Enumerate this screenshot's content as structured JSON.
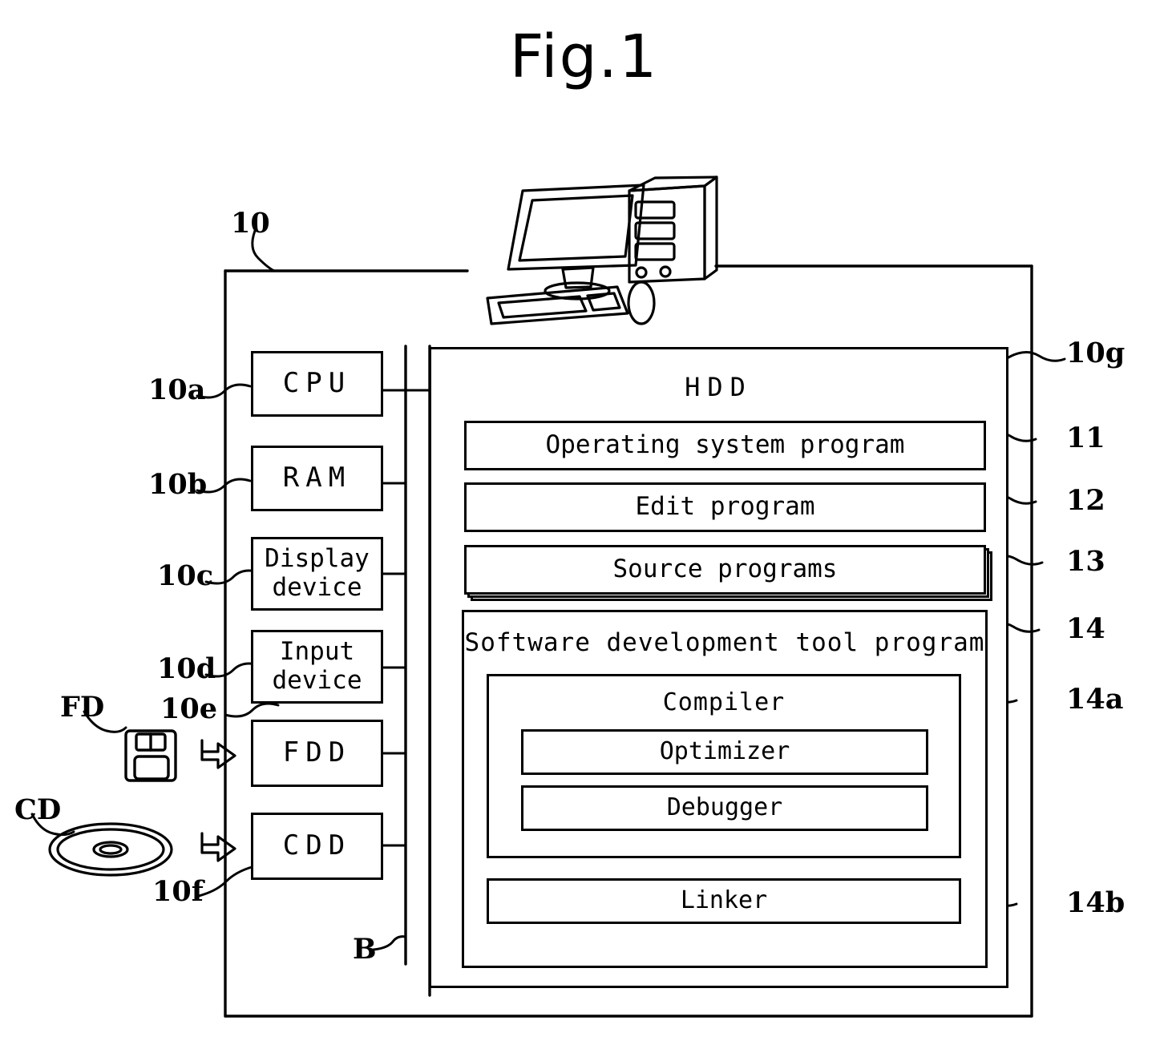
{
  "figure": {
    "title": "Fig.1",
    "type": "patent-block-diagram"
  },
  "outer": {
    "ref": "10"
  },
  "illustration": {
    "name": "computer-illustration",
    "parts": [
      "monitor",
      "tower",
      "keyboard",
      "mouse"
    ]
  },
  "bus": {
    "label": "B"
  },
  "media": {
    "floppy": {
      "label": "FD",
      "icon": "floppy-disk-icon"
    },
    "cd": {
      "label": "CD",
      "icon": "compact-disc-icon"
    }
  },
  "devices": [
    {
      "ref": "10a",
      "label": "CPU",
      "spaced": true
    },
    {
      "ref": "10b",
      "label": "RAM",
      "spaced": true
    },
    {
      "ref": "10c",
      "label": "Display\ndevice",
      "spaced": false
    },
    {
      "ref": "10d",
      "label": "Input\ndevice",
      "spaced": false
    },
    {
      "ref": "10e",
      "label": "FDD",
      "spaced": true
    },
    {
      "ref": "10f",
      "label": "CDD",
      "spaced": true
    }
  ],
  "hdd": {
    "ref": "10g",
    "title": "HDD",
    "items": [
      {
        "ref": "11",
        "label": "Operating system program"
      },
      {
        "ref": "12",
        "label": "Edit program"
      },
      {
        "ref": "13",
        "label": "Source programs",
        "stacked": true
      }
    ],
    "tool": {
      "ref": "14",
      "title": "Software development tool program",
      "compiler": {
        "ref": "14a",
        "title": "Compiler",
        "items": [
          {
            "label": "Optimizer"
          },
          {
            "label": "Debugger"
          }
        ]
      },
      "linker": {
        "ref": "14b",
        "label": "Linker"
      }
    }
  },
  "colors": {
    "stroke": "#000000",
    "background": "#ffffff"
  }
}
